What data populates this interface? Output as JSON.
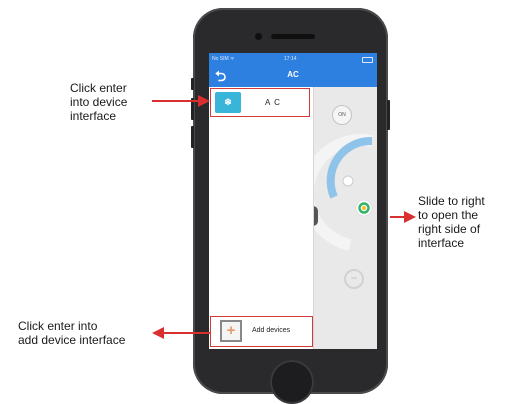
{
  "status_bar": {
    "carrier": "No SIM ᯤ",
    "time": "17:14"
  },
  "nav": {
    "back_glyph": "⮌",
    "title": "AC"
  },
  "device_list": {
    "items": [
      {
        "label": "A C",
        "thumb_glyph": "❄"
      }
    ],
    "add_button": {
      "label": "Add devices",
      "glyph": "+"
    }
  },
  "control": {
    "power_label": "ON",
    "minus_glyph": "−"
  },
  "annotations": {
    "device": [
      "Click enter",
      "into device",
      "interface"
    ],
    "slide": [
      "Slide to right",
      "to open the",
      "right side of",
      "interface"
    ],
    "add": [
      "Click enter into",
      "add device interface"
    ]
  },
  "colors": {
    "nav_blue": "#2d7fe0",
    "highlight_red": "#d23a3a",
    "arrow_red": "#d9302f",
    "dial_blue": "#8fc3ea"
  },
  "icons": {
    "back": "back-arrow-icon",
    "ac_thumb": "ac-unit-icon",
    "add": "plus-icon",
    "power": "power-icon"
  }
}
